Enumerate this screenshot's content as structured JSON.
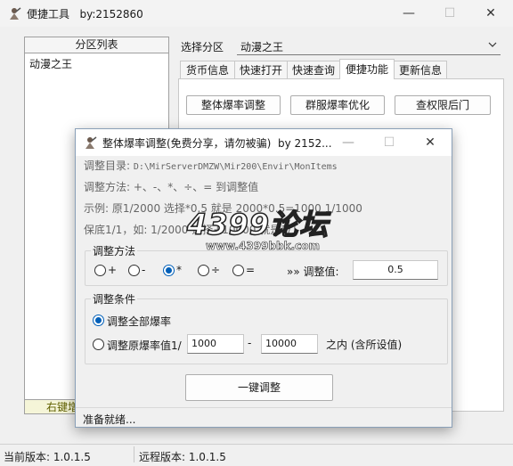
{
  "main_window": {
    "title": "便捷工具",
    "subtitle": "by:2152860",
    "close_glyph": "✕",
    "min_glyph": "—",
    "max_glyph": "☐"
  },
  "partition_panel": {
    "header": "分区列表",
    "items": [
      "动漫之王"
    ],
    "footer_partial": "右键增"
  },
  "select_partition": {
    "label": "选择分区",
    "value": "动漫之王"
  },
  "tabs": [
    {
      "label": "货币信息"
    },
    {
      "label": "快速打开"
    },
    {
      "label": "快速查询"
    },
    {
      "label": "便捷功能",
      "active": true
    },
    {
      "label": "更新信息"
    }
  ],
  "tab_buttons": {
    "overall": "整体爆率调整",
    "group": "群服爆率优化",
    "backdoor": "查权限后门"
  },
  "statusbar": {
    "local_version": "当前版本: 1.0.1.5",
    "remote_version": "远程版本: 1.0.1.5"
  },
  "dialog": {
    "title": "整体爆率调整(免费分享，请勿被骗)",
    "title_suffix": "by 2152...",
    "dir_label": "调整目录:",
    "dir_value": "D:\\MirServerDMZW\\Mir200\\Envir\\MonItems",
    "method_hint": "调整方法: +、-、*、÷、=   到调整值",
    "example": "示例: 原1/2000 选择*0.5 就是 2000*0.5=1000  1/1000",
    "min_note": "保底1/1，如: 1/2000 选择+10000 就是1/1",
    "method_group": {
      "label": "调整方法",
      "options": [
        "+",
        "-",
        "*",
        "÷",
        "="
      ],
      "selected": "*",
      "value_label": "»» 调整值:",
      "value": "0.5"
    },
    "condition_group": {
      "label": "调整条件",
      "all_label": "调整全部爆率",
      "range_label": "调整原爆率值1/",
      "range_from": "1000",
      "range_sep": "-",
      "range_to": "10000",
      "range_suffix": "之内 (含所设值)"
    },
    "apply_button": "一键调整",
    "status": "准备就绪..."
  },
  "watermark": {
    "main": "4399论坛",
    "sub": "www.4399bbk.com"
  },
  "colors": {
    "accent": "#005fb8",
    "watermark_red": "#e60012"
  }
}
